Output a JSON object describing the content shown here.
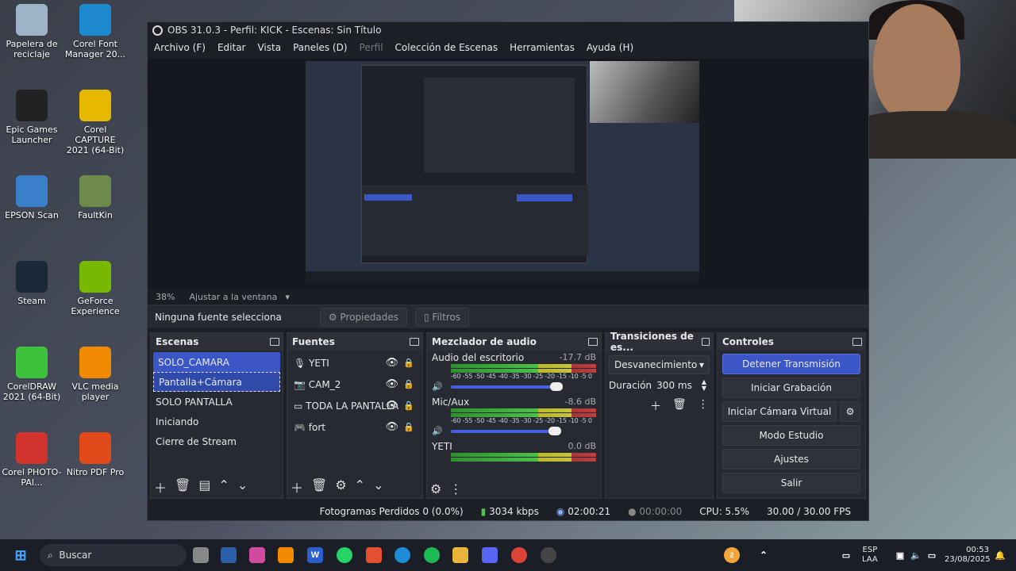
{
  "desktop_icons": [
    {
      "label": "Papelera de reciclaje",
      "icon": "recycle-bin-icon",
      "color": "#9fb3c8"
    },
    {
      "label": "Corel Font Manager 20...",
      "icon": "corel-font-manager-icon",
      "color": "#1d8ad0"
    },
    {
      "label": "Epic Games Launcher",
      "icon": "epic-games-icon",
      "color": "#222222"
    },
    {
      "label": "Corel CAPTURE 2021 (64-Bit)",
      "icon": "corel-capture-icon",
      "color": "#e6b800"
    },
    {
      "label": "EPSON Scan",
      "icon": "epson-scan-icon",
      "color": "#3a7fc9"
    },
    {
      "label": "FaultKin",
      "icon": "faultkin-icon",
      "color": "#6e8a4a"
    },
    {
      "label": "Steam",
      "icon": "steam-icon",
      "color": "#1b2838"
    },
    {
      "label": "GeForce Experience",
      "icon": "geforce-icon",
      "color": "#76b900"
    },
    {
      "label": "CorelDRAW 2021 (64-Bit)",
      "icon": "coreldraw-icon",
      "color": "#3ec23e"
    },
    {
      "label": "VLC media player",
      "icon": "vlc-icon",
      "color": "#f08a00"
    },
    {
      "label": "Corel PHOTO-PAI...",
      "icon": "corel-photo-paint-icon",
      "color": "#d0342c"
    },
    {
      "label": "Nitro PDF Pro",
      "icon": "nitro-pdf-icon",
      "color": "#e04a1a"
    }
  ],
  "obs": {
    "title": "OBS 31.0.3 - Perfil: KICK - Escenas: Sin Título",
    "menu": [
      "Archivo (F)",
      "Editar",
      "Vista",
      "Paneles (D)",
      "Perfil",
      "Colección de Escenas",
      "Herramientas",
      "Ayuda (H)"
    ],
    "zoom": "38%",
    "fit_label": "Ajustar a la ventana",
    "no_source": "Ninguna fuente selecciona",
    "properties_label": "Propiedades",
    "filters_label": "Filtros",
    "scenes": {
      "title": "Escenas",
      "items": [
        "SOLO_CAMARA",
        "Pantalla+Cámara",
        "SOLO PANTALLA",
        "Iniciando",
        "Cierre de Stream"
      ]
    },
    "sources": {
      "title": "Fuentes",
      "items": [
        {
          "name": "YETI",
          "icon": "microphone-icon"
        },
        {
          "name": "CAM_2",
          "icon": "camera-icon"
        },
        {
          "name": "TODA LA PANTALLA",
          "icon": "monitor-icon"
        },
        {
          "name": "fort",
          "icon": "gamepad-icon"
        }
      ]
    },
    "mixer": {
      "title": "Mezclador de audio",
      "ticks": "-60 -55 -50 -45 -40 -35 -30 -25 -20 -15 -10 -5  0",
      "channels": [
        {
          "name": "Audio del escritorio",
          "db": "-17.7 dB",
          "level": 0.9
        },
        {
          "name": "Mic/Aux",
          "db": "-8.6 dB",
          "level": 0.98
        },
        {
          "name": "YETI",
          "db": "0.0 dB",
          "level": 1.0
        }
      ]
    },
    "transitions": {
      "title": "Transiciones de es...",
      "selected": "Desvanecimiento",
      "duration_label": "Duración",
      "duration_value": "300 ms"
    },
    "controls": {
      "title": "Controles",
      "stop_stream": "Detener Transmisión",
      "start_recording": "Iniciar Grabación",
      "virtual_cam": "Iniciar Cámara Virtual",
      "studio_mode": "Modo Estudio",
      "settings": "Ajustes",
      "exit": "Salir"
    },
    "status": {
      "dropped": "Fotogramas Perdidos 0 (0.0%)",
      "bitrate": "3034 kbps",
      "stream_time": "02:00:21",
      "rec_time": "00:00:00",
      "cpu": "CPU: 5.5%",
      "fps": "30.00 / 30.00 FPS"
    }
  },
  "taskbar": {
    "search_placeholder": "Buscar",
    "lang": "ESP",
    "region": "LAA",
    "time": "00:53",
    "date": "23/08/2025",
    "notif_badge": "2"
  },
  "colors": {
    "accent": "#3b56c6",
    "panel": "#272a33"
  }
}
